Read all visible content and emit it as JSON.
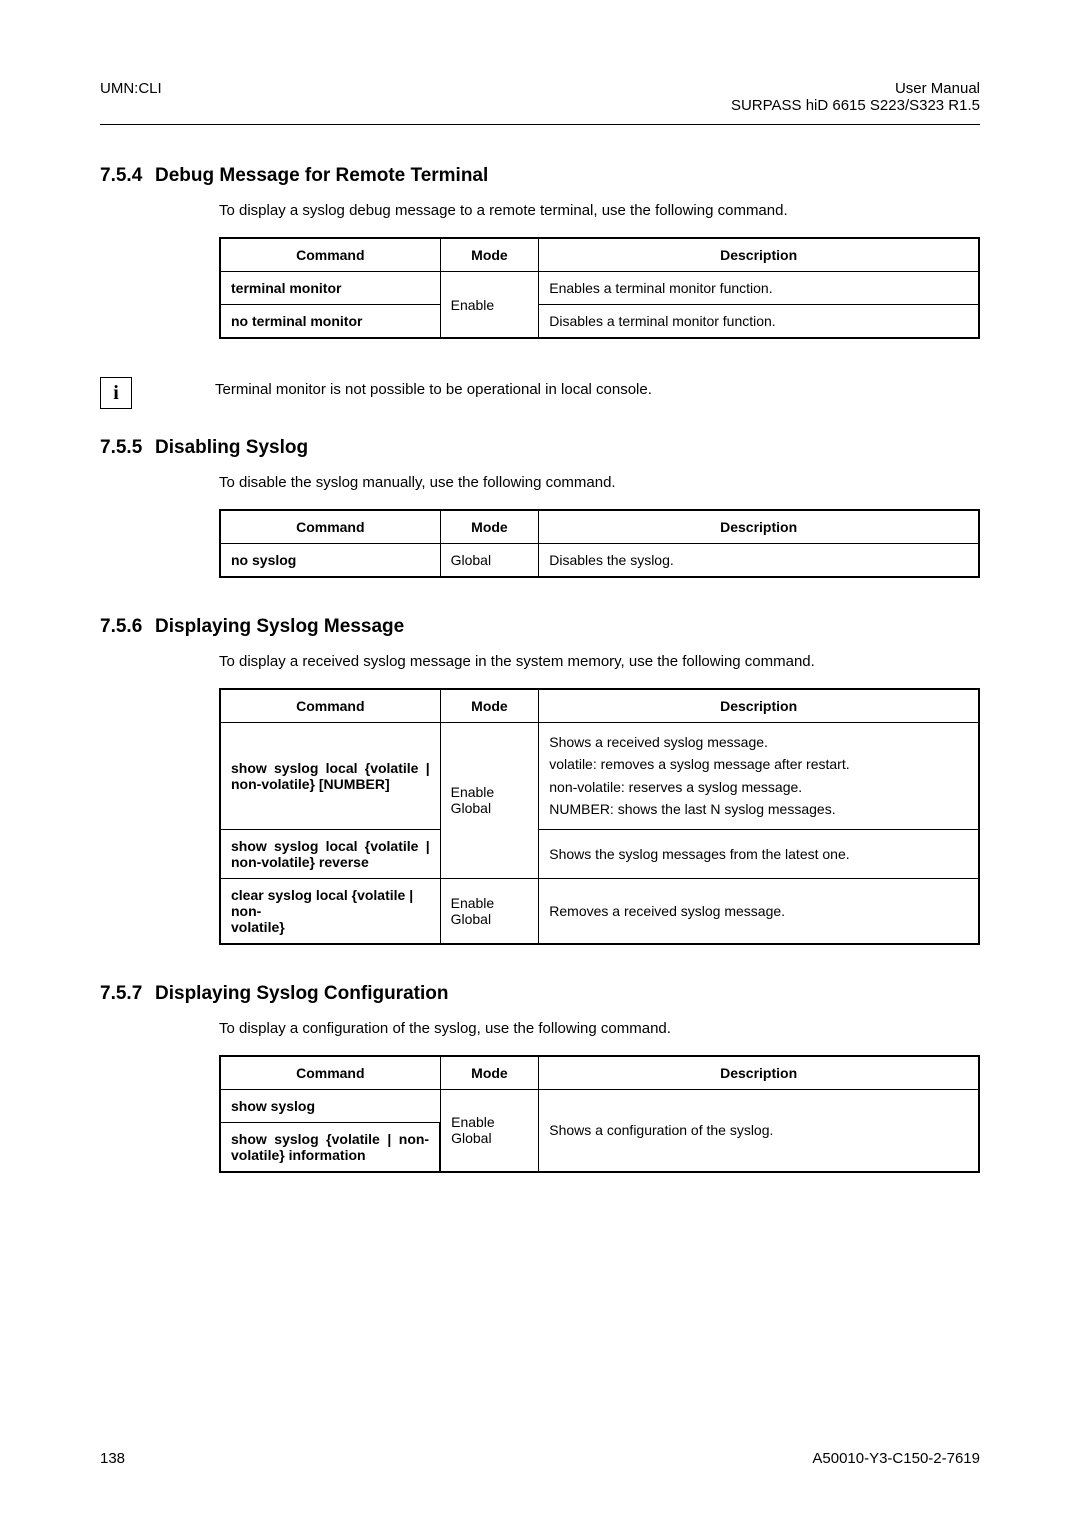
{
  "header": {
    "left": "UMN:CLI",
    "right_line1": "User Manual",
    "right_line2": "SURPASS hiD 6615 S223/S323 R1.5"
  },
  "section_754": {
    "num": "7.5.4",
    "title": "Debug Message for Remote Terminal",
    "intro": "To display a syslog debug message to a remote terminal, use the following command.",
    "th_cmd": "Command",
    "th_mode": "Mode",
    "th_desc": "Description",
    "rows": [
      {
        "cmd": "terminal monitor",
        "desc": "Enables a terminal monitor function."
      },
      {
        "cmd": "no terminal monitor",
        "desc": "Disables a terminal monitor function."
      }
    ],
    "mode": "Enable"
  },
  "info_note": {
    "icon": "i",
    "text": "Terminal monitor is not possible to be operational in local console."
  },
  "section_755": {
    "num": "7.5.5",
    "title": "Disabling Syslog",
    "intro": "To disable the syslog manually, use the following command.",
    "th_cmd": "Command",
    "th_mode": "Mode",
    "th_desc": "Description",
    "row": {
      "cmd": "no syslog",
      "mode": "Global",
      "desc": "Disables the syslog."
    }
  },
  "section_756": {
    "num": "7.5.6",
    "title": "Displaying Syslog Message",
    "intro": "To display a received syslog message in the system memory, use the following command.",
    "th_cmd": "Command",
    "th_mode": "Mode",
    "th_desc": "Description",
    "row1_cmd_l1": "show syslog local {volatile |",
    "row1_cmd_l2": "non-volatile} [NUMBER]",
    "row1_desc_l1": "Shows a received syslog message.",
    "row1_desc_l2": "volatile: removes a syslog message after restart.",
    "row1_desc_l3": "non-volatile: reserves a syslog message.",
    "row1_desc_l4": "NUMBER: shows the last N syslog messages.",
    "mode12_l1": "Enable",
    "mode12_l2": "Global",
    "row2_cmd_l1": "show syslog local {volatile |",
    "row2_cmd_l2": "non-volatile} reverse",
    "row2_desc": "Shows the syslog messages from the latest one.",
    "row3_cmd_l1": "clear syslog local {volatile | non-",
    "row3_cmd_l2": "volatile}",
    "row3_mode_l1": "Enable",
    "row3_mode_l2": "Global",
    "row3_desc": "Removes a received syslog message."
  },
  "section_757": {
    "num": "7.5.7",
    "title": "Displaying Syslog Configuration",
    "intro": "To display a configuration of the syslog, use the following command.",
    "th_cmd": "Command",
    "th_mode": "Mode",
    "th_desc": "Description",
    "row1_cmd": "show syslog",
    "row2_cmd_l1": "show syslog {volatile | non-",
    "row2_cmd_l2": "volatile} information",
    "mode_l1": "Enable",
    "mode_l2": "Global",
    "desc": "Shows a configuration of the syslog."
  },
  "footer": {
    "page": "138",
    "docid": "A50010-Y3-C150-2-7619"
  }
}
